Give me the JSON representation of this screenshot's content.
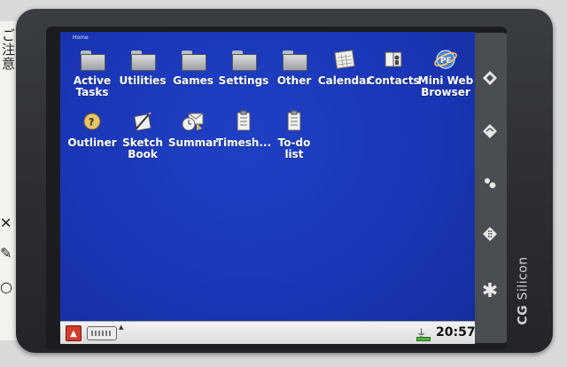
{
  "screen": {
    "title": "Home",
    "background_color": "#1a36b6"
  },
  "apps": [
    {
      "label": "Active Tasks",
      "icon": "folder-icon",
      "kind": "folder"
    },
    {
      "label": "Utilities",
      "icon": "folder-icon",
      "kind": "folder"
    },
    {
      "label": "Games",
      "icon": "folder-icon",
      "kind": "folder"
    },
    {
      "label": "Settings",
      "icon": "folder-icon",
      "kind": "folder"
    },
    {
      "label": "Other",
      "icon": "folder-icon",
      "kind": "folder"
    },
    {
      "label": "Calendar",
      "icon": "calendar-icon",
      "kind": "app"
    },
    {
      "label": "Contacts",
      "icon": "contacts-icon",
      "kind": "app"
    },
    {
      "label": "Mini Web Browser",
      "icon": "browser-icon",
      "kind": "app"
    },
    {
      "label": "Outliner",
      "icon": "outliner-icon",
      "kind": "app"
    },
    {
      "label": "Sketch Book",
      "icon": "sketchbook-icon",
      "kind": "app"
    },
    {
      "label": "Summar",
      "icon": "summary-icon",
      "kind": "app"
    },
    {
      "label": "Timesh...",
      "icon": "timesheet-icon",
      "kind": "app"
    },
    {
      "label": "To-do list",
      "icon": "todo-icon",
      "kind": "app"
    }
  ],
  "taskbar": {
    "clock": "20:57",
    "start_icon": "start-menu-icon",
    "keyboard_icon": "keyboard-icon",
    "power_icon": "power-plug-icon",
    "battery_icon": "battery-icon"
  },
  "device": {
    "brand": "CG Silicon",
    "buttons": [
      "home-icon",
      "mail-icon",
      "contacts-hw-icon",
      "keypad-icon",
      "star-icon"
    ]
  },
  "sticker": {
    "text": "ご注意"
  }
}
